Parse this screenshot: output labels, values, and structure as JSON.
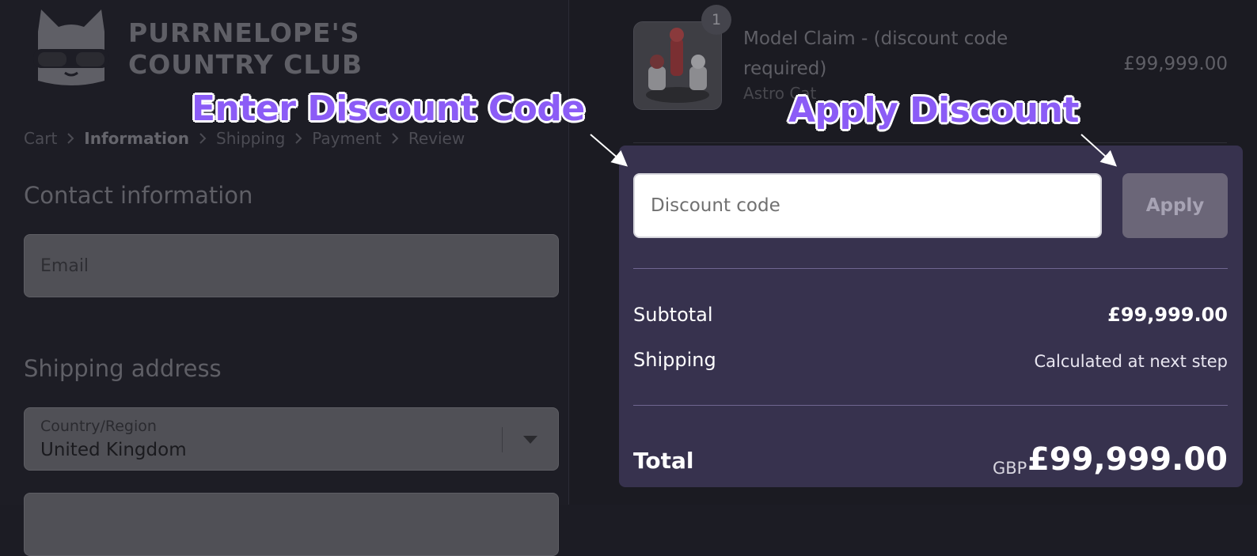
{
  "store": {
    "logo_line1": "PURRNELOPE'S",
    "logo_line2": "COUNTRY CLUB"
  },
  "breadcrumb": [
    {
      "label": "Cart",
      "current": false
    },
    {
      "label": "Information",
      "current": true
    },
    {
      "label": "Shipping",
      "current": false
    },
    {
      "label": "Payment",
      "current": false
    },
    {
      "label": "Review",
      "current": false
    }
  ],
  "contact": {
    "heading": "Contact information",
    "email_placeholder": "Email"
  },
  "shipping_address": {
    "heading": "Shipping address",
    "country_label": "Country/Region",
    "country_value": "United Kingdom"
  },
  "product": {
    "quantity": "1",
    "title": "Model Claim - (discount code required)",
    "variant": "Astro Cat",
    "price": "£99,999.00"
  },
  "discount": {
    "placeholder": "Discount code",
    "apply_label": "Apply"
  },
  "summary": {
    "subtotal_label": "Subtotal",
    "subtotal_value": "£99,999.00",
    "shipping_label": "Shipping",
    "shipping_value": "Calculated at next step",
    "total_label": "Total",
    "currency": "GBP",
    "total_value": "£99,999.00"
  },
  "annotations": {
    "enter_code": "Enter Discount Code",
    "apply_discount": "Apply Discount"
  }
}
